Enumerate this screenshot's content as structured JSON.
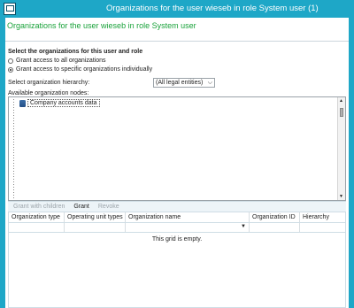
{
  "window": {
    "title": "Organizations for the user wieseb in role System user (1)",
    "header": "Organizations for the user wieseb in role System user"
  },
  "section": {
    "title": "Select the organizations for this user and role",
    "radios": [
      {
        "label": "Grant access to all organizations",
        "checked": false
      },
      {
        "label": "Grant access to specific organizations individually",
        "checked": true
      }
    ]
  },
  "hierarchy": {
    "label": "Select organization hierarchy:",
    "selected": "(All legal entities)"
  },
  "tree": {
    "label": "Available organization nodes:",
    "items": [
      "Company accounts data"
    ]
  },
  "toolbar": {
    "grant_with_children": "Grant with children",
    "grant": "Grant",
    "revoke": "Revoke"
  },
  "grid": {
    "columns": [
      "Organization type",
      "Operating unit types",
      "Organization name",
      "Organization ID",
      "Hierarchy"
    ],
    "empty_text": "This grid is empty."
  },
  "colors": {
    "title_bar": "#1ea7c7",
    "header_text": "#19a23a"
  },
  "icons": {
    "app": "app-window-icon",
    "tree_node": "database-icon",
    "scroll_up": "scroll-up-arrow-icon",
    "scroll_down": "scroll-down-arrow-icon",
    "dropdown": "chevron-down-icon"
  }
}
